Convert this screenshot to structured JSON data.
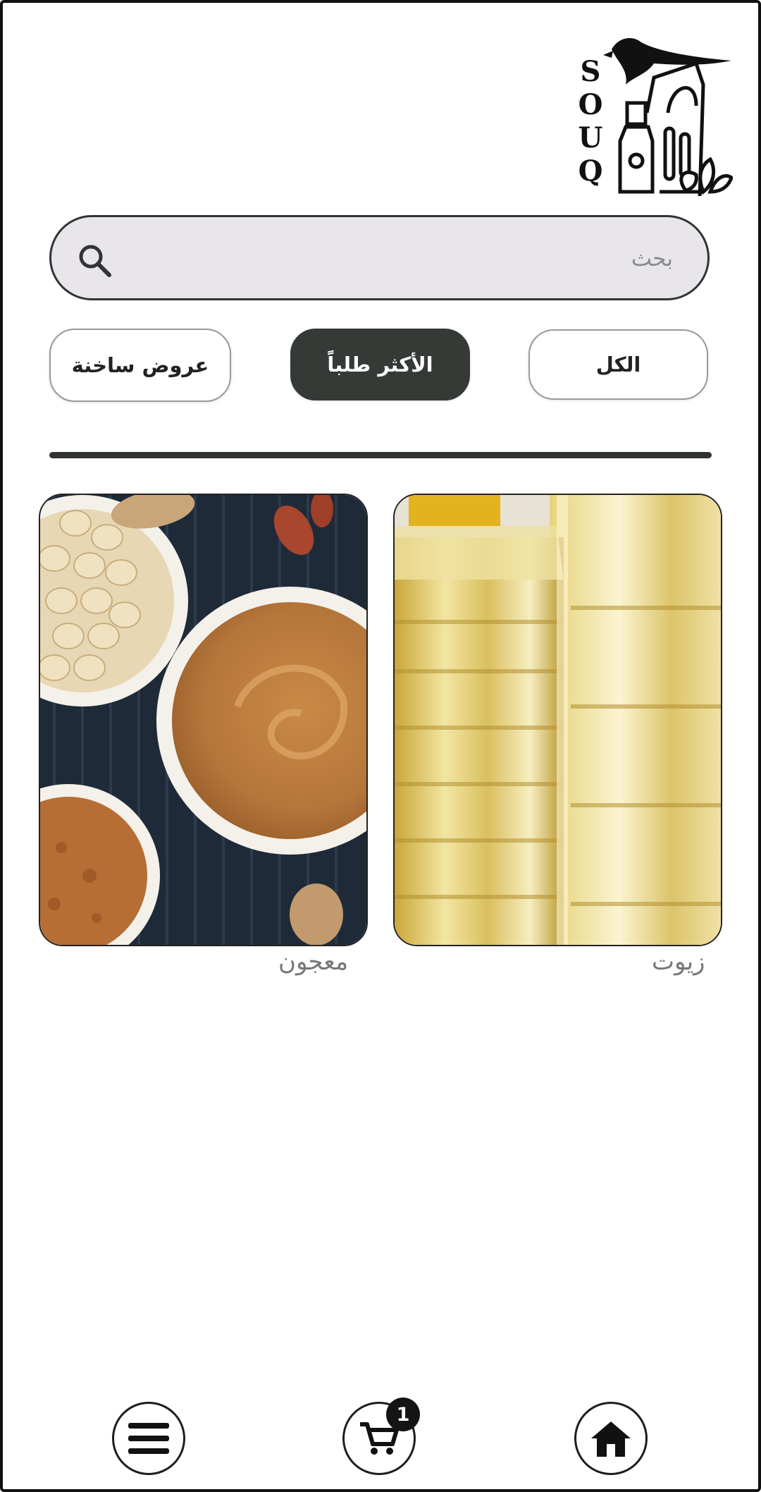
{
  "logo": {
    "letters": [
      "S",
      "O",
      "U",
      "Q"
    ]
  },
  "search": {
    "placeholder": "بحث",
    "value": ""
  },
  "tabs": [
    {
      "label": "الكل",
      "active": false
    },
    {
      "label": "الأكثر طلباً",
      "active": true
    },
    {
      "label": "عروض ساخنة",
      "active": false
    }
  ],
  "products": [
    {
      "label": "زيوت",
      "image": "oil-bottles-photo"
    },
    {
      "label": "معجون",
      "image": "peanut-butter-photo"
    }
  ],
  "bottom_nav": {
    "items": [
      {
        "icon": "home-icon"
      },
      {
        "icon": "cart-icon"
      },
      {
        "icon": "menu-icon"
      }
    ],
    "cart_count": "1"
  },
  "colors": {
    "accent": "#363a37",
    "search_bg": "#e8e6ea"
  }
}
